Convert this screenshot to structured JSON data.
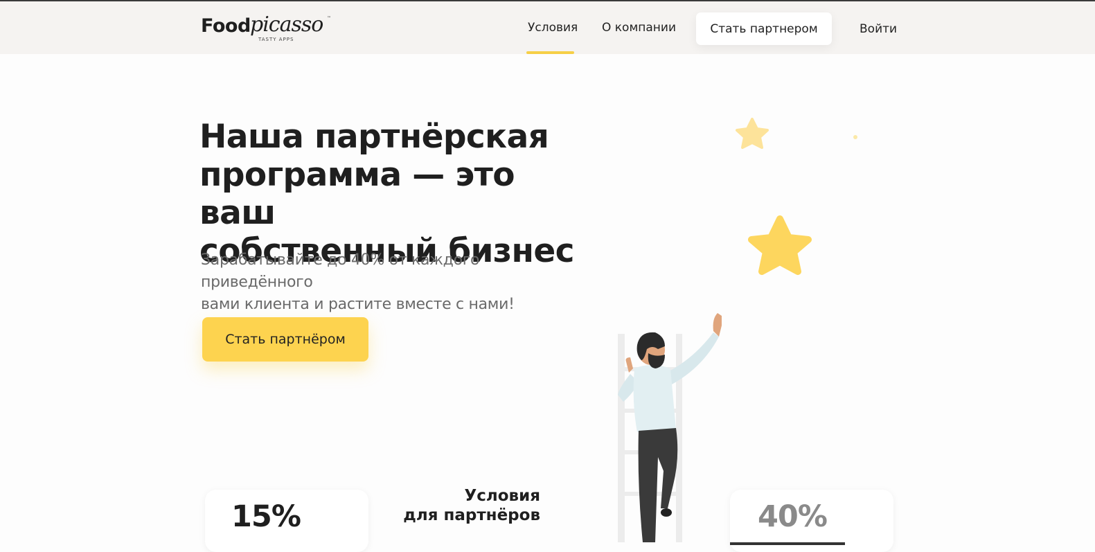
{
  "header": {
    "logo": {
      "main": "Food",
      "script": "picasso",
      "tagline": "TASTY APPS",
      "tm": "™"
    },
    "nav": [
      {
        "label": "Условия"
      },
      {
        "label": "О компании"
      }
    ],
    "partner_button": "Стать партнером",
    "login": "Войти"
  },
  "hero": {
    "title_line1": "Наша партнёрская",
    "title_line2": "программа — это ваш",
    "title_line3": "собственный бизнес",
    "subtitle_line1": "Зарабатывайте до 40% от каждого приведённого",
    "subtitle_line2": "вами клиента и растите вместе с нами!",
    "cta": "Стать партнёром"
  },
  "conditions": {
    "title_line1": "Условия",
    "title_line2": "для партнёров",
    "card_left": "15%",
    "card_right": "40%"
  },
  "colors": {
    "accent": "#fdd34f",
    "header_bg": "#f5f3f1",
    "star": "#fdd86a"
  }
}
